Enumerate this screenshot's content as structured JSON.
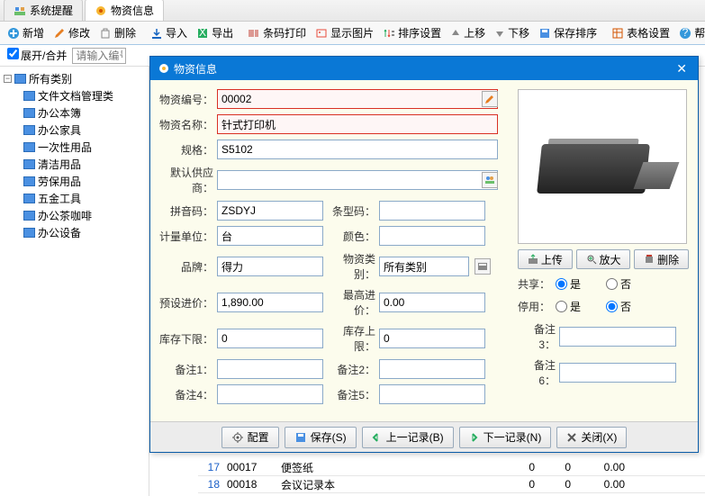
{
  "tabs": [
    {
      "label": "系统提醒"
    },
    {
      "label": "物资信息"
    }
  ],
  "toolbar": {
    "add": "新增",
    "edit": "修改",
    "del": "删除",
    "import": "导入",
    "export": "导出",
    "barcode": "条码打印",
    "showimg": "显示图片",
    "sortcfg": "排序设置",
    "up": "上移",
    "down": "下移",
    "savesort": "保存排序",
    "tablecfg": "表格设置",
    "help": "帮"
  },
  "subbar": {
    "expand": "展开/合并",
    "placeholder": "请输入编号\\"
  },
  "tree": {
    "root": "所有类别",
    "items": [
      "文件文档管理类",
      "办公本簿",
      "办公家具",
      "一次性用品",
      "清洁用品",
      "劳保用品",
      "五金工具",
      "办公茶咖啡",
      "办公设备"
    ]
  },
  "modal": {
    "title": "物资信息",
    "labels": {
      "code": "物资编号：",
      "name": "物资名称：",
      "spec": "规格：",
      "supplier": "默认供应商：",
      "pinyin": "拼音码：",
      "barcode": "条型码：",
      "unit": "计量单位：",
      "color": "颜色：",
      "brand": "品牌：",
      "category": "物资类别：",
      "preprice": "预设进价：",
      "maxprice": "最高进价：",
      "stockmin": "库存下限：",
      "stockmax": "库存上限：",
      "r1": "备注1：",
      "r2": "备注2：",
      "r3": "备注3：",
      "r4": "备注4：",
      "r5": "备注5：",
      "r6": "备注6："
    },
    "values": {
      "code": "00002",
      "name": "针式打印机",
      "spec": "S5102",
      "supplier": "",
      "pinyin": "ZSDYJ",
      "barcode": "",
      "unit": "台",
      "color": "",
      "brand": "得力",
      "category": "所有类别",
      "preprice": "1,890.00",
      "maxprice": "0.00",
      "stockmin": "0",
      "stockmax": "0",
      "r1": "",
      "r2": "",
      "r3": "",
      "r4": "",
      "r5": "",
      "r6": ""
    },
    "imgbtns": {
      "upload": "上传",
      "zoom": "放大",
      "del": "删除"
    },
    "share": {
      "label": "共享：",
      "yes": "是",
      "no": "否",
      "value": "yes"
    },
    "disable": {
      "label": "停用：",
      "yes": "是",
      "no": "否",
      "value": "no"
    },
    "footer": {
      "config": "配置",
      "save": "保存(S)",
      "prev": "上一记录(B)",
      "next": "下一记录(N)",
      "close": "关闭(X)"
    }
  },
  "grid": {
    "rows": [
      {
        "n": "17",
        "code": "00017",
        "name": "便签纸",
        "a": "0",
        "b": "0",
        "price": "0.00"
      },
      {
        "n": "18",
        "code": "00018",
        "name": "会议记录本",
        "a": "0",
        "b": "0",
        "price": "0.00"
      }
    ]
  }
}
